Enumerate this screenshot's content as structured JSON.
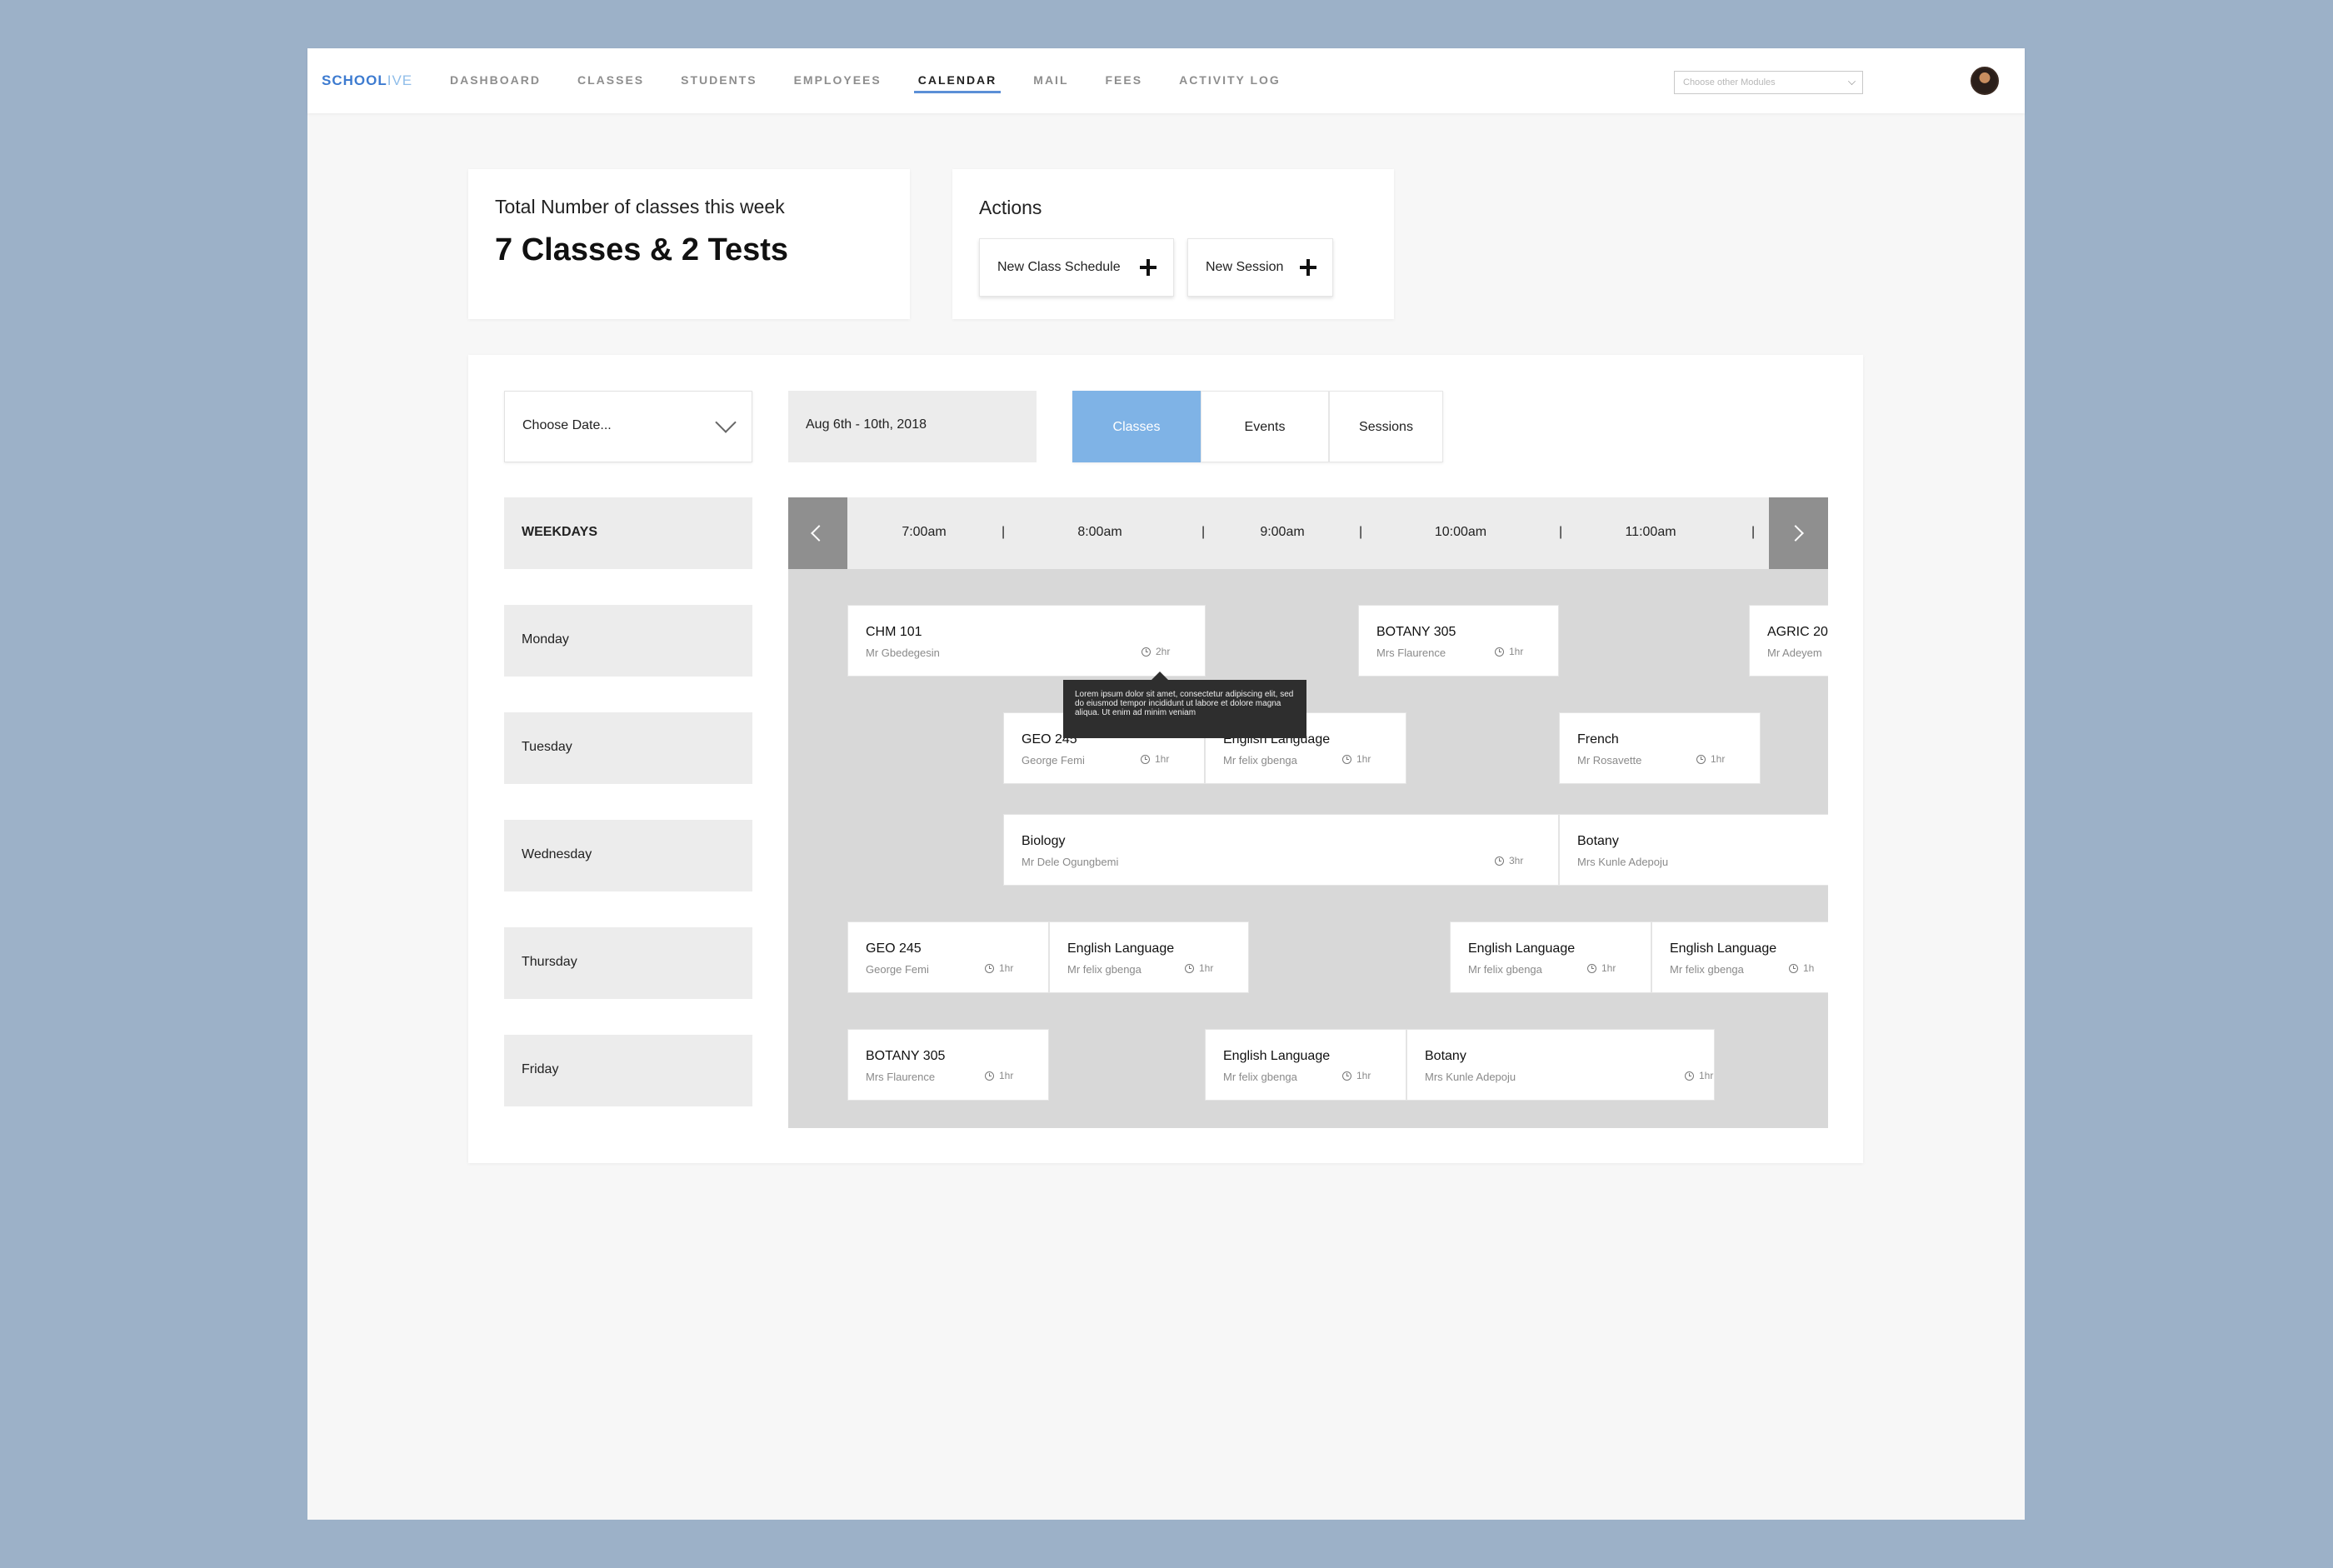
{
  "brand": {
    "part1": "SCHOOL",
    "part2": "IVE"
  },
  "nav": {
    "items": [
      "DASHBOARD",
      "CLASSES",
      "STUDENTS",
      "EMPLOYEES",
      "CALENDAR",
      "MAIL",
      "FEES",
      "ACTIVITY LOG"
    ],
    "active": "CALENDAR"
  },
  "module_select": {
    "placeholder": "Choose other Modules"
  },
  "stats": {
    "title": "Total Number of classes this week",
    "value": "7 Classes & 2 Tests"
  },
  "actions": {
    "title": "Actions",
    "new_class_schedule": "New Class Schedule",
    "new_session": "New Session"
  },
  "filters": {
    "choose_date": "Choose Date...",
    "date_range": "Aug 6th - 10th, 2018"
  },
  "tabs": [
    "Classes",
    "Events",
    "Sessions"
  ],
  "active_tab": "Classes",
  "weekdays": {
    "header": "WEEKDAYS",
    "days": [
      "Monday",
      "Tuesday",
      "Wednesday",
      "Thursday",
      "Friday"
    ]
  },
  "time_labels": [
    "7:00am",
    "8:00am",
    "9:00am",
    "10:00am",
    "11:00am"
  ],
  "tooltip": "Lorem ipsum dolor sit amet, consectetur adipiscing elit, sed do eiusmod tempor incididunt ut labore et dolore magna aliqua. Ut enim ad minim veniam",
  "schedule": {
    "Monday": [
      {
        "name": "CHM 101",
        "teacher": "Mr Gbedegesin",
        "duration": "2hr"
      },
      {
        "name": "BOTANY 305",
        "teacher": "Mrs Flaurence",
        "duration": "1hr"
      },
      {
        "name": "AGRIC 20",
        "teacher": "Mr Adeyem",
        "duration": ""
      }
    ],
    "Tuesday": [
      {
        "name": "GEO 245",
        "teacher": "George Femi",
        "duration": "1hr"
      },
      {
        "name": "English Language",
        "teacher": "Mr felix gbenga",
        "duration": "1hr"
      },
      {
        "name": "French",
        "teacher": "Mr Rosavette",
        "duration": "1hr"
      }
    ],
    "Wednesday": [
      {
        "name": "Biology",
        "teacher": "Mr Dele Ogungbemi",
        "duration": "3hr"
      },
      {
        "name": "Botany",
        "teacher": "Mrs Kunle Adepoju",
        "duration": ""
      }
    ],
    "Thursday": [
      {
        "name": "GEO 245",
        "teacher": "George Femi",
        "duration": "1hr"
      },
      {
        "name": "English Language",
        "teacher": "Mr felix gbenga",
        "duration": "1hr"
      },
      {
        "name": "English Language",
        "teacher": "Mr felix gbenga",
        "duration": "1hr"
      },
      {
        "name": "English Language",
        "teacher": "Mr felix gbenga",
        "duration": "1h"
      }
    ],
    "Friday": [
      {
        "name": "BOTANY 305",
        "teacher": "Mrs Flaurence",
        "duration": "1hr"
      },
      {
        "name": "English Language",
        "teacher": "Mr felix gbenga",
        "duration": "1hr"
      },
      {
        "name": "Botany",
        "teacher": "Mrs Kunle Adepoju",
        "duration": "1hr"
      }
    ]
  },
  "colors": {
    "accent": "#5b8fd6",
    "active_tab": "#7fb3e6",
    "background": "#9cb1c8"
  }
}
